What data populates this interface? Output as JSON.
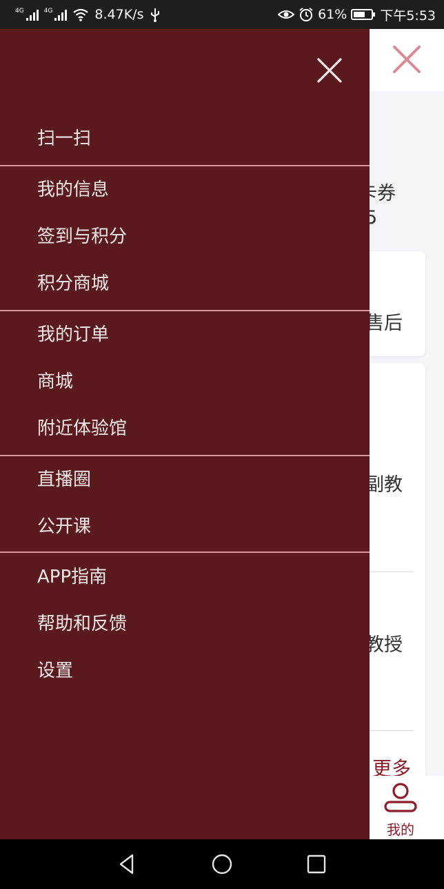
{
  "status_bar": {
    "network_1": "4G",
    "network_2": "4G",
    "speed": "8.47K/s",
    "battery": "61%",
    "time": "下午5:53",
    "icons": [
      "signal-icon",
      "signal-icon",
      "wifi-icon",
      "usb-icon",
      "eye-icon",
      "alarm-icon",
      "battery-icon"
    ]
  },
  "background": {
    "card_voucher_label": "卡券",
    "card_voucher_count": "5",
    "after_sales_label": "售后",
    "row_1_fragment": "副教",
    "row_2_fragment": "教授",
    "more_label": "更多",
    "tab_me_label": "我的",
    "accent": "#8b1e2a"
  },
  "drawer": {
    "background_color": "#5a1a1d",
    "divider_color": "#d49aa0",
    "groups": [
      {
        "items": [
          {
            "label": "扫一扫"
          }
        ]
      },
      {
        "items": [
          {
            "label": "我的信息"
          },
          {
            "label": "签到与积分"
          },
          {
            "label": "积分商城"
          }
        ]
      },
      {
        "items": [
          {
            "label": "我的订单"
          },
          {
            "label": "商城"
          },
          {
            "label": "附近体验馆"
          }
        ]
      },
      {
        "items": [
          {
            "label": "直播圈"
          },
          {
            "label": "公开课"
          }
        ]
      },
      {
        "items": [
          {
            "label": "APP指南"
          },
          {
            "label": "帮助和反馈"
          },
          {
            "label": "设置"
          }
        ]
      }
    ]
  },
  "nav_bar": {
    "buttons": [
      "back-icon",
      "home-icon",
      "recents-icon"
    ]
  }
}
